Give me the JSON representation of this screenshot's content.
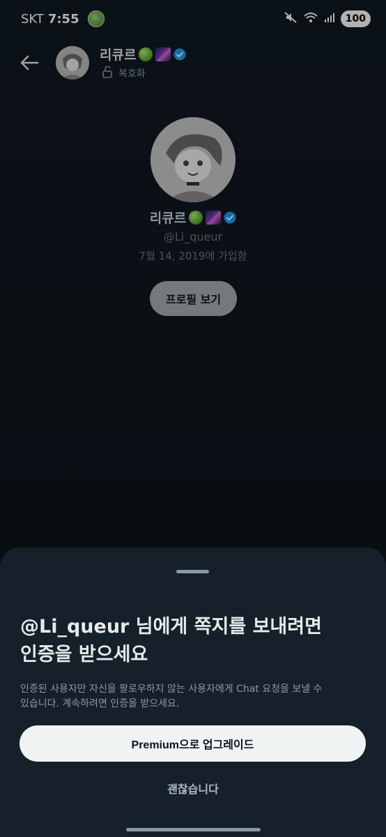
{
  "status_bar": {
    "carrier": "SKT",
    "time": "7:55",
    "battery": "100"
  },
  "header": {
    "name": "리큐르",
    "subtitle": "복호화"
  },
  "profile": {
    "name": "리큐르",
    "handle": "@Li_queur",
    "joined": "7월 14, 2019에 가입함",
    "view_profile_label": "프로필 보기"
  },
  "sheet": {
    "title_line1": "@Li_queur 님에게 쪽지를 보내려면",
    "title_line2": "인증을 받으세요",
    "body_line1": "인증된 사용자만 자신을 팔로우하지 않는 사용자에게 Chat 요청을 보낼 수",
    "body_line2": "있습니다. 계속하려면 인증을 받으세요.",
    "premium_label": "Premium으로 업그레이드",
    "dismiss_label": "괜찮습니다"
  },
  "colors": {
    "background": "#0f1419",
    "sheet": "#16202a",
    "verified": "#1d9bf0",
    "primary_button": "#eff3f4"
  },
  "icons": {
    "back": "arrow-left-icon",
    "lock": "unlock-icon",
    "verified": "verified-badge-icon",
    "mute": "mute-icon",
    "wifi": "wifi-icon",
    "signal": "signal-icon"
  }
}
